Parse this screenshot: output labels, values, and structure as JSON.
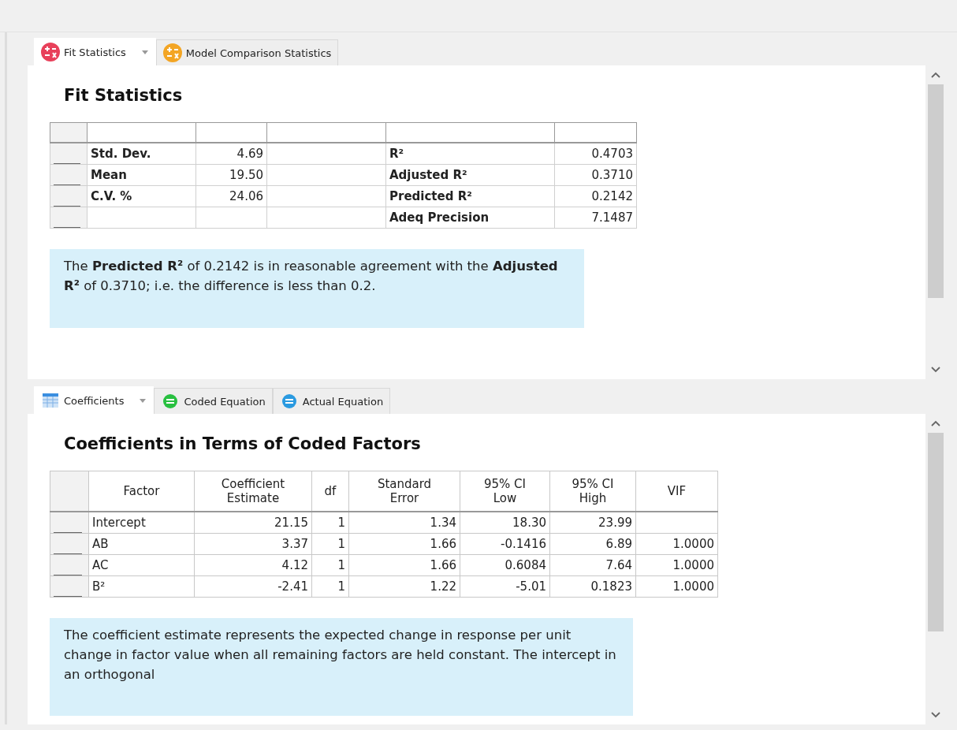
{
  "panels": [
    {
      "tabs": [
        {
          "label": "Fit Statistics",
          "selected": true,
          "dropdown": true,
          "kind": "operators",
          "color": "#e8405a"
        },
        {
          "label": "Model Comparison Statistics",
          "selected": false,
          "dropdown": false,
          "kind": "operators",
          "color": "#f3a524"
        }
      ],
      "title": "Fit Statistics",
      "rows": [
        {
          "label": "Std. Dev.",
          "value": "4.69",
          "stat": "R²",
          "stat_value": "0.4703"
        },
        {
          "label": "Mean",
          "value": "19.50",
          "stat": "Adjusted R²",
          "stat_value": "0.3710"
        },
        {
          "label": "C.V. %",
          "value": "24.06",
          "stat": "Predicted R²",
          "stat_value": "0.2142"
        },
        {
          "stat": "Adeq Precision",
          "stat_value": "7.1487"
        }
      ],
      "note": "The **Predicted R²** of 0.2142 is in reasonable agreement with the **Adjusted R²** of 0.3710; i.e. the difference is less than 0.2."
    },
    {
      "tabs": [
        {
          "label": "Coefficients",
          "selected": true,
          "dropdown": true,
          "kind": "grid",
          "color": "#3a8ee0"
        },
        {
          "label": "Coded Equation",
          "selected": false,
          "dropdown": false,
          "kind": "equals",
          "color": "#28c040"
        },
        {
          "label": "Actual Equation",
          "selected": false,
          "dropdown": false,
          "kind": "equals",
          "color": "#2a9ae0"
        }
      ],
      "title": "Coefficients in Terms of Coded Factors",
      "columns": [
        "Factor",
        "Coefficient\nEstimate",
        "df",
        "Standard\nError",
        "95% CI\nLow",
        "95% CI\nHigh",
        "VIF"
      ],
      "rows": [
        [
          "Intercept",
          "21.15",
          "1",
          "1.34",
          "18.30",
          "23.99"
        ],
        [
          "AB",
          "3.37",
          "1",
          "1.66",
          "-0.1416",
          "6.89",
          "1.0000"
        ],
        [
          "AC",
          "4.12",
          "1",
          "1.66",
          "0.6084",
          "7.64",
          "1.0000"
        ],
        [
          "B²",
          "-2.41",
          "1",
          "1.22",
          "-5.01",
          "0.1823",
          "1.0000"
        ]
      ],
      "note": "The coefficient estimate represents the expected change in response per unit change in factor value when all remaining factors are held constant. The intercept in an orthogonal"
    }
  ]
}
